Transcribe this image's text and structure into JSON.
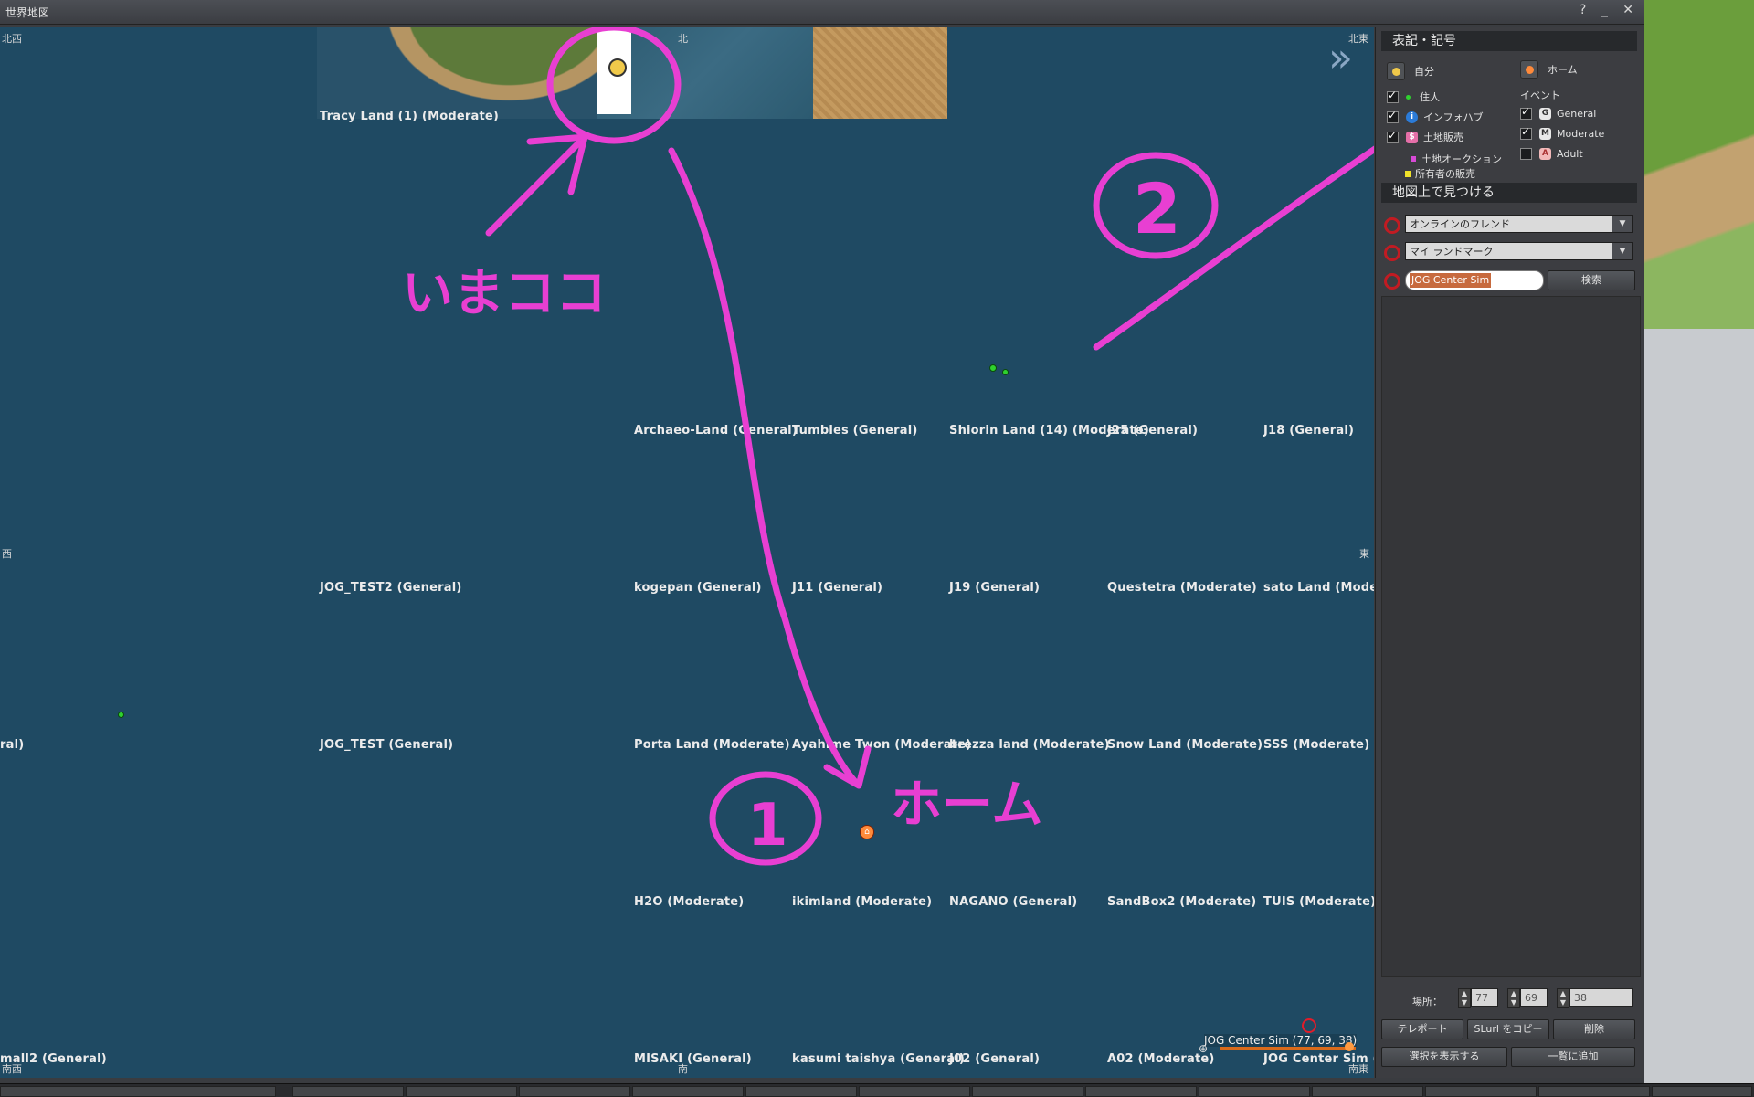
{
  "window": {
    "title": "世界地図",
    "help": "?",
    "minimize": "_",
    "close": "✕"
  },
  "map": {
    "compass": {
      "nw": "北西",
      "n": "北",
      "ne": "北東",
      "w": "西",
      "e": "東",
      "sw": "南西",
      "s": "南",
      "se": "南東"
    },
    "regions": [
      "Tracy Land (1) (Moderate)",
      "Archaeo-Land (General)",
      "Tumbles (General)",
      "Shiorin Land (14) (Moderate)",
      "J25 (General)",
      "J18 (General)",
      "JOG_TEST2 (General)",
      "kogepan (General)",
      "J11 (General)",
      "J19 (General)",
      "Questetra (Moderate)",
      "sato Land (Moder",
      "ral)",
      "JOG_TEST (General)",
      "Porta Land (Moderate)",
      "Ayahime Twon (Moderate)",
      "brezza land (Moderate)",
      "Snow Land (Moderate)",
      "SSS (Moderate)",
      "H2O (Moderate)",
      "ikimland (Moderate)",
      "NAGANO (General)",
      "SandBox2 (Moderate)",
      "TUIS (Moderate)",
      "mall2 (General)",
      "MISAKI (General)",
      "kasumi taishya (General)",
      "J02 (General)",
      "A02 (Moderate)",
      "JOG Center Sim (G"
    ],
    "coord_readout": "JOG Center Sim (77, 69, 38)",
    "annotations": {
      "here": "いまココ",
      "home": "ホーム",
      "one": "1",
      "two": "2"
    }
  },
  "panel": {
    "legend_title": "表記・記号",
    "self": "自分",
    "home": "ホーム",
    "residents": "住人",
    "infohub": "インフォハブ",
    "land_sale": "土地販売",
    "land_auction": "土地オークション",
    "owner_sale": "所有者の販売",
    "events": "イベント",
    "general": "General",
    "moderate": "Moderate",
    "adult": "Adult",
    "find_title": "地図上で見つける",
    "friends_combo": "オンラインのフレンド",
    "landmark_combo": "マイ ランドマーク",
    "search_value": "JOG Center Sim",
    "search_button": "検索",
    "location_label": "場所：",
    "x": "77",
    "y": "69",
    "z": "38",
    "teleport": "テレポート",
    "copy_slurl": "SLurl をコピー",
    "delete": "削除",
    "show_selection": "選択を表示する",
    "add_to_list": "一覧に追加"
  }
}
